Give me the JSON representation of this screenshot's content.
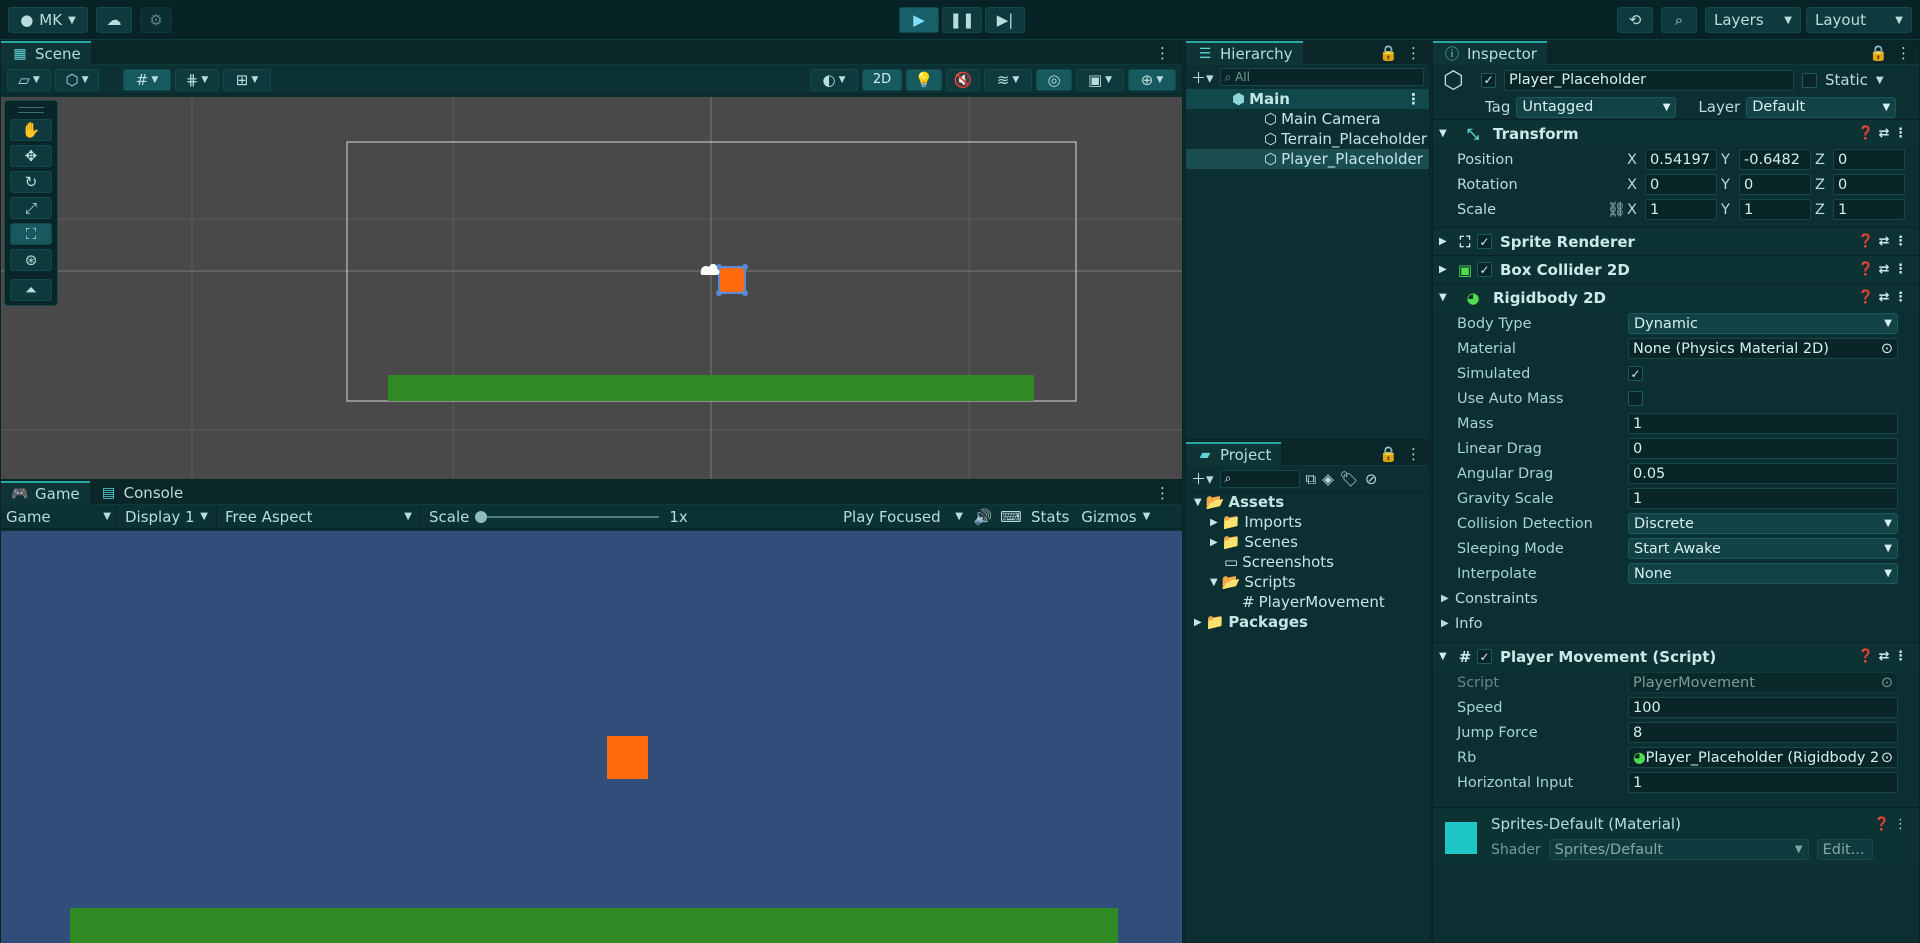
{
  "top": {
    "account": "MK",
    "layers": "Layers",
    "layout": "Layout"
  },
  "scene": {
    "tab": "Scene",
    "btn2d": "2D"
  },
  "game": {
    "tab_game": "Game",
    "tab_console": "Console",
    "mode": "Game",
    "display": "Display 1",
    "aspect": "Free Aspect",
    "scale_label": "Scale",
    "scale_value": "1x",
    "play_focused": "Play Focused",
    "stats": "Stats",
    "gizmos": "Gizmos"
  },
  "hierarchy": {
    "tab": "Hierarchy",
    "search_placeholder": "All",
    "root": "Main",
    "items": [
      "Main Camera",
      "Terrain_Placeholder",
      "Player_Placeholder"
    ]
  },
  "project": {
    "tab": "Project",
    "assets": "Assets",
    "imports": "Imports",
    "scenes": "Scenes",
    "screenshots": "Screenshots",
    "scripts": "Scripts",
    "player_movement": "PlayerMovement",
    "packages": "Packages"
  },
  "inspector": {
    "tab": "Inspector",
    "object_name": "Player_Placeholder",
    "static": "Static",
    "tag_label": "Tag",
    "tag_value": "Untagged",
    "layer_label": "Layer",
    "layer_value": "Default",
    "transform": {
      "title": "Transform",
      "position_label": "Position",
      "rotation_label": "Rotation",
      "scale_label": "Scale",
      "x": "X",
      "y": "Y",
      "z": "Z",
      "pos": [
        "0.54197",
        "-0.6482",
        "0"
      ],
      "rot": [
        "0",
        "0",
        "0"
      ],
      "scl": [
        "1",
        "1",
        "1"
      ]
    },
    "sprite_renderer": "Sprite Renderer",
    "box_collider": "Box Collider 2D",
    "rigidbody": {
      "title": "Rigidbody 2D",
      "body_type_label": "Body Type",
      "body_type": "Dynamic",
      "material_label": "Material",
      "material": "None (Physics Material 2D)",
      "simulated_label": "Simulated",
      "use_auto_mass_label": "Use Auto Mass",
      "mass_label": "Mass",
      "mass": "1",
      "linear_drag_label": "Linear Drag",
      "linear_drag": "0",
      "angular_drag_label": "Angular Drag",
      "angular_drag": "0.05",
      "gravity_scale_label": "Gravity Scale",
      "gravity_scale": "1",
      "collision_label": "Collision Detection",
      "collision": "Discrete",
      "sleeping_label": "Sleeping Mode",
      "sleeping": "Start Awake",
      "interpolate_label": "Interpolate",
      "interpolate": "None",
      "constraints": "Constraints",
      "info": "Info"
    },
    "player_movement": {
      "title": "Player Movement (Script)",
      "script_label": "Script",
      "script": "PlayerMovement",
      "speed_label": "Speed",
      "speed": "100",
      "jump_label": "Jump Force",
      "jump": "8",
      "rb_label": "Rb",
      "rb": "Player_Placeholder (Rigidbody 2",
      "horizontal_label": "Horizontal Input",
      "horizontal": "1"
    },
    "material": {
      "title": "Sprites-Default (Material)",
      "shader_label": "Shader",
      "shader": "Sprites/Default",
      "edit": "Edit..."
    }
  },
  "colors": {
    "accent": "#2aa7a7",
    "scene_bg": "#494949",
    "game_bg": "#314d79",
    "player": "#ff6b0c",
    "ground": "#2f8a24"
  }
}
